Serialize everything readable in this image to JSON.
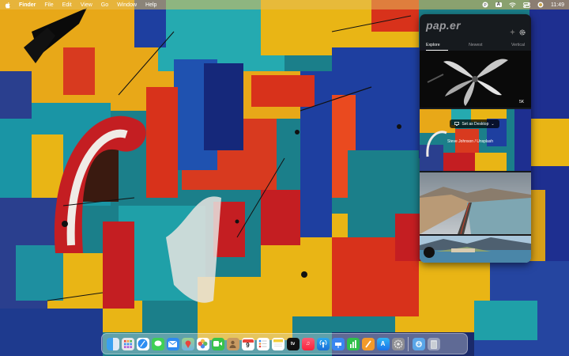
{
  "menubar": {
    "app_name": "Finder",
    "items": [
      "File",
      "Edit",
      "View",
      "Go",
      "Window",
      "Help"
    ],
    "input_source": "A",
    "clock": "11:49"
  },
  "panel": {
    "logo": "pap.er",
    "tabs": [
      "Explore",
      "Newest",
      "Vertical"
    ],
    "active_tab": "Explore",
    "set_desktop_label": "Set as Desktop",
    "photo_credit": "Steve Johnson / Unsplash",
    "resolution_badge": "5K"
  },
  "dock": {
    "calendar_day": "9",
    "apps": [
      "Finder",
      "Launchpad",
      "Safari",
      "Messages",
      "Mail",
      "Maps",
      "Photos",
      "FaceTime",
      "Contacts",
      "Reminders",
      "Notes",
      "Calendar",
      "TV",
      "Music",
      "Podcasts",
      "Keynote",
      "Numbers",
      "Pages",
      "App Store",
      "System Preferences"
    ]
  },
  "colors": {
    "menubar": "#e6be5a",
    "panel_bg": "#16161a"
  }
}
